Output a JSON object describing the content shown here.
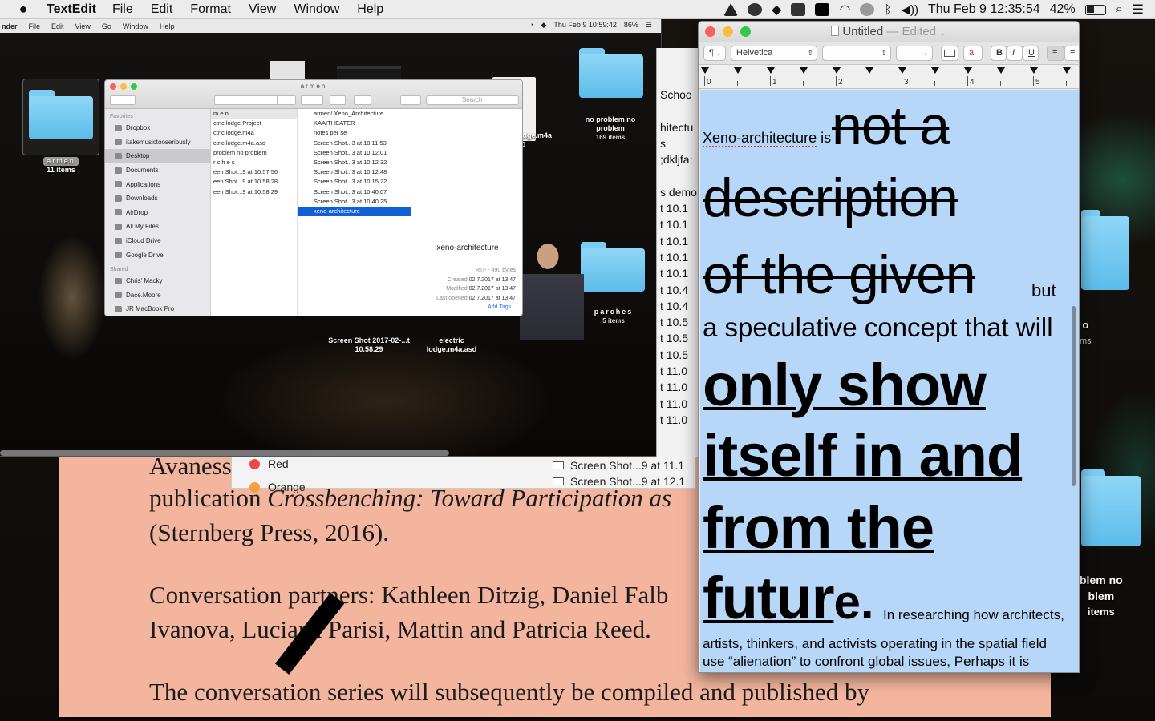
{
  "menubar": {
    "app": "TextEdit",
    "items": [
      "File",
      "Edit",
      "Format",
      "View",
      "Window",
      "Help"
    ],
    "datetime": "Thu Feb 9  12:35:54",
    "battery": "42%"
  },
  "inner_menubar": {
    "app": "nder",
    "items": [
      "File",
      "Edit",
      "View",
      "Go",
      "Window",
      "Help"
    ],
    "datetime": "Thu Feb 9  10:59:42",
    "battery": "86%"
  },
  "desktop_icons": {
    "armen": {
      "name": "armen",
      "count": "11 items"
    },
    "no_problem": {
      "name": "no problem no problem",
      "count": "169 items"
    },
    "parches": {
      "name": "parches",
      "count": "5 items"
    },
    "screenshot": {
      "name": "Screen Shot 2017-02-...t 10.58.29"
    },
    "electric": {
      "name": "electric lodge.m4a.asd"
    },
    "lodge": {
      "name": "odge.m4a",
      "count": "20"
    },
    "right_partial_1": "o",
    "right_partial_1b": "ms",
    "right_partial_2": "blem no",
    "right_partial_2b": "blem",
    "right_partial_2c": "items"
  },
  "finder": {
    "title": "armen",
    "search_placeholder": "Search",
    "sidebar_favorites_header": "Favorites",
    "sidebar_favorites": [
      "Dropbox",
      "itakemusictooseriously",
      "Desktop",
      "Documents",
      "Applications",
      "Downloads",
      "AirDrop",
      "All My Files",
      "iCloud Drive",
      "Google Drive"
    ],
    "sidebar_shared_header": "Shared",
    "sidebar_shared": [
      "Chris' Macky",
      "Dace.Moore",
      "JR MacBook Pro"
    ],
    "col1": [
      "m e n",
      "ctric lodge Project",
      "ctric lodge.m4a",
      "ctric lodge.m4a.asd",
      "problem no problem",
      "r c h e s",
      "een Shot...9 at 10.57.56",
      "een Shot...9 at 10.58.28",
      "een Shot...9 at 10.58.29"
    ],
    "col2": [
      "armen/ Xeno_Architecture",
      "KAAITHEATER",
      "notes per se",
      "Screen Shot...3 at 10.11.53",
      "Screen Shot...3 at 10.12.01",
      "Screen Shot...3 at 10.12.32",
      "Screen Shot...3 at 10.12.48",
      "Screen Shot...3 at 10.15.22",
      "Screen Shot...3 at 10.40.07",
      "Screen Shot...3 at 10.40.25",
      "xeno-architecture"
    ],
    "preview": {
      "name": "xeno-architecture",
      "kind": "RTF - 490 bytes",
      "created_label": "Created",
      "created": "02.7.2017 at 13:47",
      "modified_label": "Modified",
      "modified": "02.7.2017 at 13:47",
      "opened_label": "Last opened",
      "opened": "02.7.2017 at 13:47",
      "add_tags": "Add Tags..."
    }
  },
  "midwin": {
    "rows": [
      "Schoo",
      "",
      "hitectu",
      "s",
      ";dkljfa;",
      "",
      "s demo",
      "t 10.1",
      "t 10.1",
      "t 10.1",
      "t 10.1",
      "t 10.1",
      "t 10.4",
      "t 10.4",
      "t 10.5",
      "t 10.5",
      "t 10.5",
      "t 11.0",
      "t 11.0",
      "t 11.0",
      "t 11.0"
    ]
  },
  "label_popup": {
    "red": "Red",
    "orange": "Orange",
    "files": [
      "Screen Shot...9 at 11.1",
      "Screen Shot...9 at 12.1"
    ],
    "colors": {
      "red": "#e5484d",
      "orange": "#f5a040"
    }
  },
  "salmon_doc": {
    "line1": "Avaness",
    "line2a": "publication",
    "line2b": "Crossbenching: Toward Participation as",
    "line3": "(Sternberg Press, 2016).",
    "line4": "Conversation partners: Kathleen Ditzig, Daniel Falb",
    "line5": "Ivanova, Luciana Parisi, Mattin and Patricia Reed.",
    "line6": "The conversation series will subsequently be compiled and published by",
    "bg": "#f3b59e"
  },
  "textedit": {
    "title": "Untitled",
    "edited": "— Edited",
    "font_family": "Helvetica",
    "ruler_numbers": [
      "0",
      "1",
      "2",
      "3",
      "4",
      "5"
    ],
    "text": {
      "t1": "Xeno-architecture",
      "t1b": "is",
      "t2": "not a",
      "t3": "description",
      "t4": "of the given",
      "t4b": "but",
      "t5": "a speculative concept that will",
      "t6": "only show",
      "t7": "itself in and",
      "t8": "from the",
      "t9": "futur",
      "t9b": "e.",
      "t9c": "In researching how architects,",
      "t10": "artists, thinkers, and activists operating in the spatial field",
      "t11": "use “alienation” to confront global issues, Perhaps it is"
    },
    "page_bg": "#b6d7f8"
  }
}
